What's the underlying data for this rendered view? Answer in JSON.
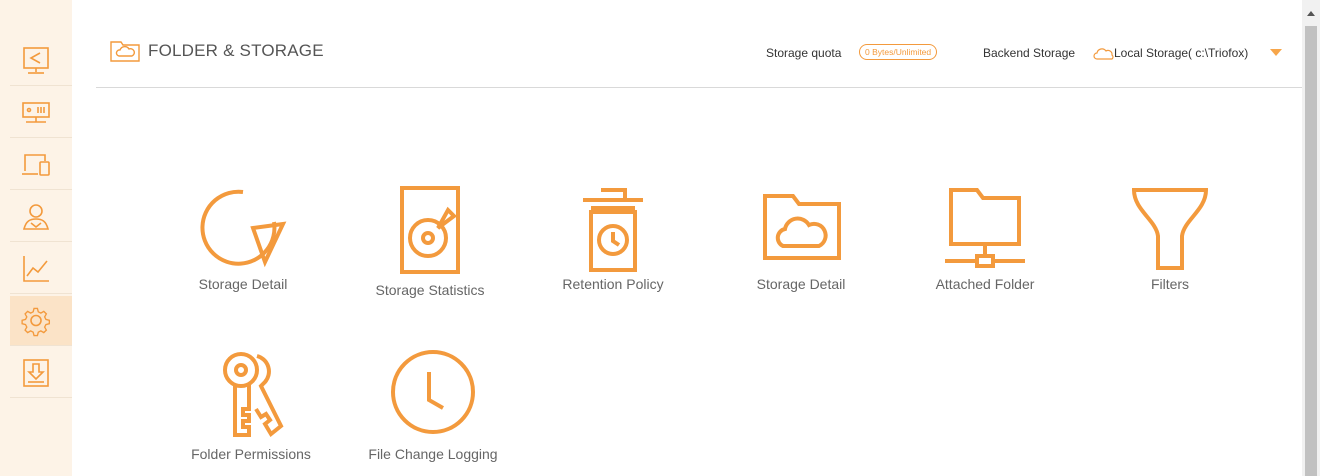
{
  "colors": {
    "accent": "#f39a3d",
    "sidebar_bg": "#fdf3e7",
    "sidebar_active": "#fbe3c7"
  },
  "sidebar": {
    "items": [
      {
        "icon": "share-screen-icon",
        "active": false
      },
      {
        "icon": "server-icon",
        "active": false
      },
      {
        "icon": "devices-icon",
        "active": false
      },
      {
        "icon": "users-icon",
        "active": false
      },
      {
        "icon": "chart-icon",
        "active": false
      },
      {
        "icon": "gear-icon",
        "active": true
      },
      {
        "icon": "download-icon",
        "active": false
      }
    ]
  },
  "header": {
    "title": "FOLDER & STORAGE",
    "storage_quota_label": "Storage quota",
    "storage_quota_value": "0 Bytes/Unlimited",
    "backend_label": "Backend Storage",
    "backend_value": "Local Storage( c:\\Triofox)"
  },
  "tiles": [
    {
      "label": "Storage Detail",
      "icon": "pie-chart-icon"
    },
    {
      "label": "Storage Statistics",
      "icon": "hard-drive-icon"
    },
    {
      "label": "Retention Policy",
      "icon": "trash-clock-icon"
    },
    {
      "label": "Storage Detail",
      "icon": "cloud-folder-icon"
    },
    {
      "label": "Attached Folder",
      "icon": "network-folder-icon"
    },
    {
      "label": "Filters",
      "icon": "funnel-icon"
    },
    {
      "label": "Folder Permissions",
      "icon": "keys-icon"
    },
    {
      "label": "File Change Logging",
      "icon": "clock-icon"
    }
  ]
}
